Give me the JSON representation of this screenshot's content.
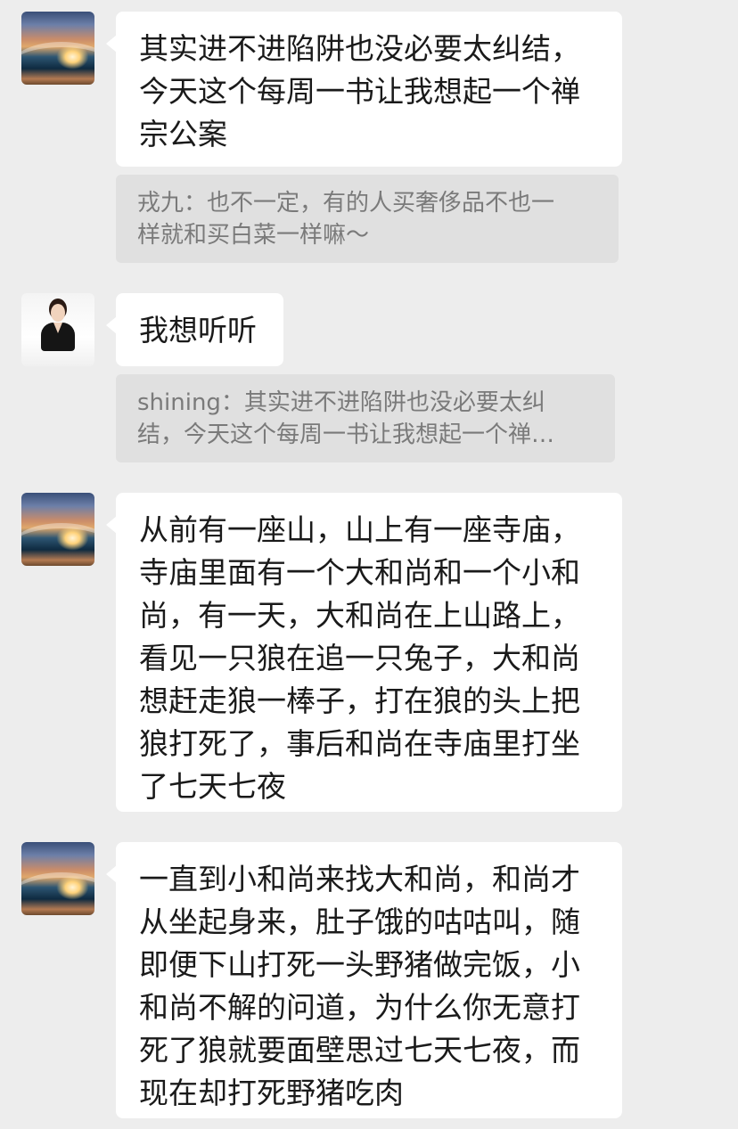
{
  "messages": [
    {
      "avatar": "wave-avatar",
      "text": "其实进不进陷阱也没必要太纠结，\n今天这个每周一书让我想起一个禅\n宗公案"
    },
    {
      "quote": "戎九：也不一定，有的人买奢侈品不也一\n样就和买白菜一样嘛～"
    },
    {
      "avatar": "person-avatar",
      "text": "我想听听"
    },
    {
      "quote": "shining：其实进不进陷阱也没必要太纠\n结，今天这个每周一书让我想起一个禅…"
    },
    {
      "avatar": "wave-avatar",
      "text": "从前有一座山，山上有一座寺庙，\n寺庙里面有一个大和尚和一个小和\n尚，有一天，大和尚在上山路上，\n看见一只狼在追一只兔子，大和尚\n想赶走狼一棒子，打在狼的头上把\n狼打死了，事后和尚在寺庙里打坐\n了七天七夜"
    },
    {
      "avatar": "wave-avatar",
      "text": "一直到小和尚来找大和尚，和尚才\n从坐起身来，肚子饿的咕咕叫，随\n即便下山打死一头野猪做完饭，小\n和尚不解的问道，为什么你无意打\n死了狼就要面壁思过七天七夜，而\n现在却打死野猪吃肉"
    }
  ]
}
